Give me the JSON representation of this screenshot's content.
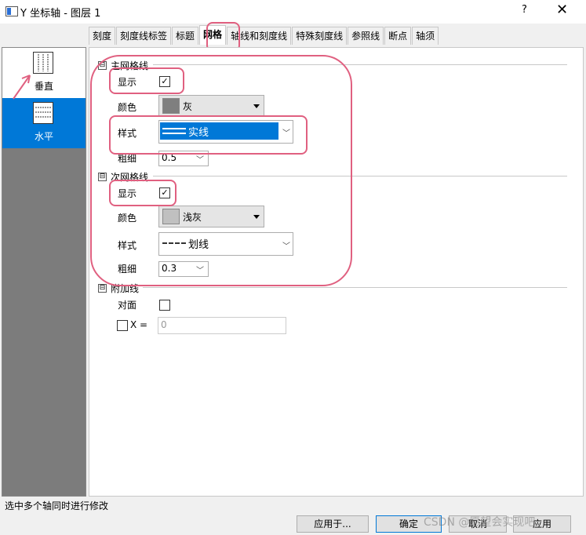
{
  "window": {
    "title": "Y 坐标轴 - 图层 1",
    "help": "?",
    "close": "✕"
  },
  "tabs": [
    "刻度",
    "刻度线标签",
    "标题",
    "网格",
    "轴线和刻度线",
    "特殊刻度线",
    "参照线",
    "断点",
    "轴须"
  ],
  "active_tab": "网格",
  "axis_list": [
    {
      "label": "垂直",
      "selected": false
    },
    {
      "label": "水平",
      "selected": true
    }
  ],
  "major_grid": {
    "section_title": "主网格线",
    "toggle": "⊟",
    "show_label": "显示",
    "show_checked": true,
    "color_label": "颜色",
    "color_value": "灰",
    "color_hex": "#7f7f7f",
    "style_label": "样式",
    "style_value": "实线",
    "width_label": "粗细",
    "width_value": "0.5"
  },
  "minor_grid": {
    "section_title": "次网格线",
    "toggle": "⊟",
    "show_label": "显示",
    "show_checked": true,
    "color_label": "颜色",
    "color_value": "浅灰",
    "color_hex": "#c0c0c0",
    "style_label": "样式",
    "style_value": "划线",
    "width_label": "粗细",
    "width_value": "0.3"
  },
  "additional": {
    "section_title": "附加线",
    "toggle": "⊟",
    "opposite_label": "对面",
    "x_label": "X =",
    "x_value": "0"
  },
  "status_text": "选中多个轴同时进行修改",
  "buttons": {
    "apply_to": "应用于...",
    "ok": "确定",
    "cancel": "取消",
    "apply": "应用"
  },
  "watermark": "CSDN @愿望会实现吧",
  "colors": {
    "accent": "#0078d7",
    "annotation": "#e06080"
  }
}
